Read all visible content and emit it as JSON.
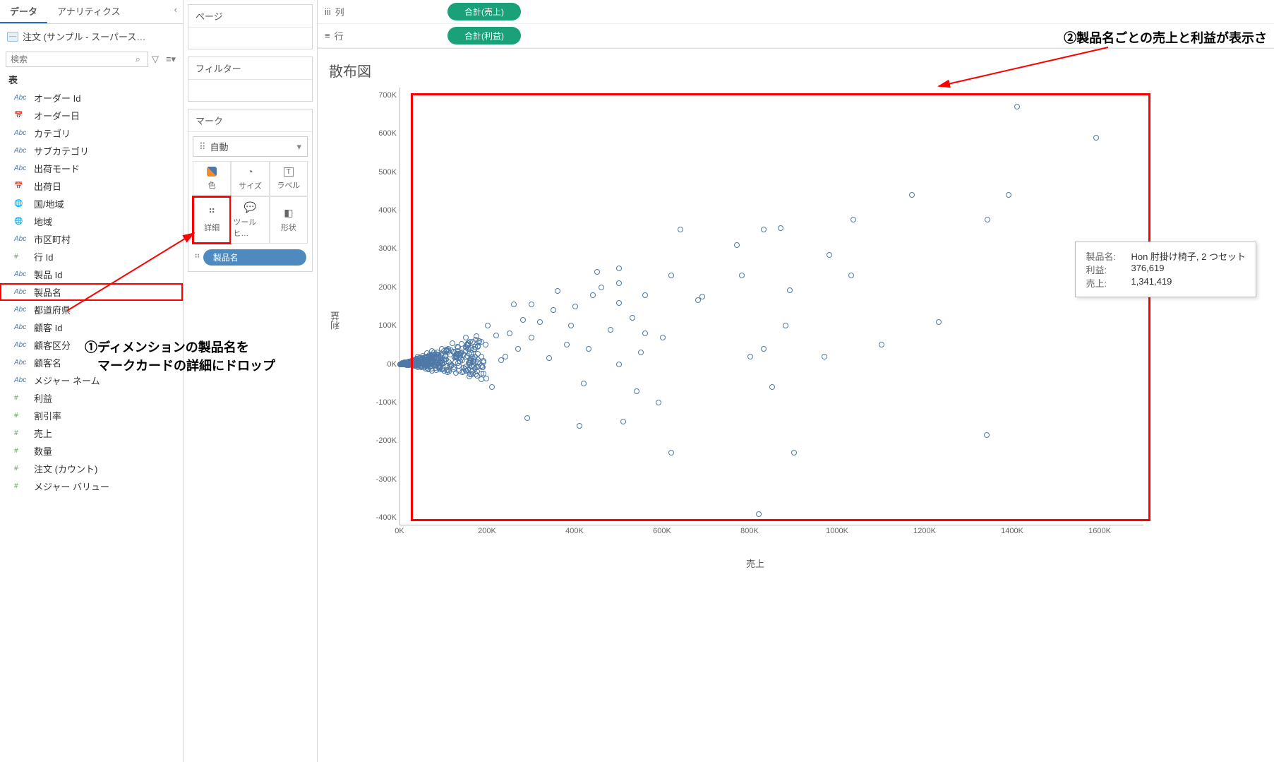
{
  "sidebar": {
    "tabs": {
      "data": "データ",
      "analytics": "アナリティクス"
    },
    "datasource": "注文 (サンプル - スーパース…",
    "search_placeholder": "検索",
    "section_header": "表",
    "fields": [
      {
        "type": "Abc",
        "name": "オーダー Id"
      },
      {
        "type": "date",
        "name": "オーダー日"
      },
      {
        "type": "Abc",
        "name": "カテゴリ"
      },
      {
        "type": "Abc",
        "name": "サブカテゴリ"
      },
      {
        "type": "Abc",
        "name": "出荷モード"
      },
      {
        "type": "date",
        "name": "出荷日"
      },
      {
        "type": "geo",
        "name": "国/地域"
      },
      {
        "type": "geo",
        "name": "地域"
      },
      {
        "type": "Abc",
        "name": "市区町村"
      },
      {
        "type": "#",
        "name": "行 Id"
      },
      {
        "type": "Abc",
        "name": "製品 Id"
      },
      {
        "type": "Abc",
        "name": "製品名",
        "highlighted": true
      },
      {
        "type": "Abc",
        "name": "都道府県"
      },
      {
        "type": "Abc",
        "name": "顧客 Id"
      },
      {
        "type": "Abc",
        "name": "顧客区分"
      },
      {
        "type": "Abc",
        "name": "顧客名"
      },
      {
        "type": "Abc",
        "name": "メジャー ネーム"
      },
      {
        "type": "#",
        "name": "利益"
      },
      {
        "type": "#",
        "name": "割引率"
      },
      {
        "type": "#",
        "name": "売上"
      },
      {
        "type": "#",
        "name": "数量"
      },
      {
        "type": "#",
        "name": "注文 (カウント)"
      },
      {
        "type": "#",
        "name": "メジャー バリュー"
      }
    ]
  },
  "cards": {
    "pages": "ページ",
    "filters": "フィルター",
    "marks": "マーク",
    "mark_type": "自動",
    "cells": {
      "color": "色",
      "size": "サイズ",
      "label": "ラベル",
      "detail": "詳細",
      "tooltip": "ツールヒ…",
      "shape": "形状"
    },
    "detail_pill": "製品名"
  },
  "shelves": {
    "columns_label": "列",
    "columns_pill": "合計(売上)",
    "rows_label": "行",
    "rows_pill": "合計(利益)"
  },
  "viz": {
    "title": "散布図",
    "y_axis": "利益",
    "x_axis": "売上",
    "y_ticks": [
      "700K",
      "600K",
      "500K",
      "400K",
      "300K",
      "200K",
      "100K",
      "0K",
      "-100K",
      "-200K",
      "-300K",
      "-400K"
    ],
    "x_ticks": [
      "0K",
      "200K",
      "400K",
      "600K",
      "800K",
      "1000K",
      "1200K",
      "1400K",
      "1600K"
    ],
    "tooltip": {
      "name_label": "製品名:",
      "name_val": "Hon 肘掛け椅子, 2 つセット",
      "profit_label": "利益:",
      "profit_val": "376,619",
      "sales_label": "売上:",
      "sales_val": "1,341,419"
    }
  },
  "annotations": {
    "step1": "①ディメンションの製品名を\n　マークカードの詳細にドロップ",
    "step2": "②製品名ごとの売上と利益が表示さ"
  },
  "chart_data": {
    "type": "scatter",
    "xlabel": "売上",
    "ylabel": "利益",
    "xlim": [
      0,
      1700000
    ],
    "ylim": [
      -420000,
      720000
    ],
    "sample_points_note": "Dense cluster near origin; hundreds of products. Representative points estimated from axes.",
    "series": [
      {
        "name": "製品",
        "points": [
          [
            1341419,
            376619
          ],
          [
            1410000,
            670000
          ],
          [
            1590000,
            590000
          ],
          [
            1390000,
            440000
          ],
          [
            1170000,
            440000
          ],
          [
            1035000,
            376000
          ],
          [
            1340000,
            -185000
          ],
          [
            980000,
            285000
          ],
          [
            1030000,
            230000
          ],
          [
            1100000,
            50000
          ],
          [
            1230000,
            110000
          ],
          [
            970000,
            20000
          ],
          [
            880000,
            100000
          ],
          [
            870000,
            355000
          ],
          [
            830000,
            350000
          ],
          [
            900000,
            -230000
          ],
          [
            820000,
            -390000
          ],
          [
            890000,
            192000
          ],
          [
            830000,
            40000
          ],
          [
            850000,
            -60000
          ],
          [
            800000,
            20000
          ],
          [
            780000,
            230000
          ],
          [
            770000,
            310000
          ],
          [
            690000,
            175000
          ],
          [
            680000,
            167000
          ],
          [
            640000,
            350000
          ],
          [
            620000,
            230000
          ],
          [
            600000,
            70000
          ],
          [
            590000,
            -100000
          ],
          [
            620000,
            -230000
          ],
          [
            560000,
            180000
          ],
          [
            560000,
            80000
          ],
          [
            550000,
            30000
          ],
          [
            530000,
            120000
          ],
          [
            540000,
            -70000
          ],
          [
            500000,
            250000
          ],
          [
            500000,
            210000
          ],
          [
            500000,
            160000
          ],
          [
            500000,
            0
          ],
          [
            510000,
            -150000
          ],
          [
            480000,
            90000
          ],
          [
            460000,
            200000
          ],
          [
            450000,
            240000
          ],
          [
            440000,
            180000
          ],
          [
            430000,
            40000
          ],
          [
            420000,
            -50000
          ],
          [
            410000,
            -160000
          ],
          [
            400000,
            150000
          ],
          [
            390000,
            100000
          ],
          [
            380000,
            50000
          ],
          [
            360000,
            190000
          ],
          [
            350000,
            140000
          ],
          [
            340000,
            15000
          ],
          [
            320000,
            110000
          ],
          [
            300000,
            155000
          ],
          [
            300000,
            70000
          ],
          [
            290000,
            -140000
          ],
          [
            280000,
            115000
          ],
          [
            270000,
            40000
          ],
          [
            260000,
            155000
          ],
          [
            250000,
            80000
          ],
          [
            240000,
            20000
          ],
          [
            230000,
            10000
          ],
          [
            220000,
            75000
          ],
          [
            210000,
            -60000
          ],
          [
            200000,
            100000
          ],
          [
            195000,
            50000
          ],
          [
            190000,
            5000
          ],
          [
            180000,
            60000
          ],
          [
            175000,
            -30000
          ],
          [
            170000,
            40000
          ],
          [
            165000,
            20000
          ],
          [
            160000,
            10000
          ],
          [
            155000,
            50000
          ],
          [
            150000,
            70000
          ],
          [
            145000,
            -20000
          ],
          [
            140000,
            30000
          ],
          [
            135000,
            15000
          ],
          [
            130000,
            45000
          ],
          [
            125000,
            5000
          ],
          [
            120000,
            55000
          ],
          [
            115000,
            25000
          ],
          [
            110000,
            -15000
          ],
          [
            105000,
            35000
          ],
          [
            100000,
            10000
          ],
          [
            95000,
            40000
          ],
          [
            90000,
            20000
          ],
          [
            88000,
            -10000
          ],
          [
            85000,
            30000
          ],
          [
            82000,
            5000
          ],
          [
            80000,
            25000
          ],
          [
            78000,
            15000
          ],
          [
            75000,
            8000
          ],
          [
            72000,
            35000
          ],
          [
            70000,
            -5000
          ],
          [
            68000,
            20000
          ],
          [
            65000,
            10000
          ],
          [
            62000,
            28000
          ],
          [
            60000,
            3000
          ],
          [
            58000,
            18000
          ],
          [
            55000,
            7000
          ],
          [
            52000,
            22000
          ],
          [
            50000,
            12000
          ],
          [
            48000,
            -8000
          ],
          [
            45000,
            15000
          ],
          [
            42000,
            5000
          ],
          [
            40000,
            20000
          ],
          [
            38000,
            8000
          ],
          [
            35000,
            12000
          ],
          [
            32000,
            3000
          ],
          [
            30000,
            10000
          ],
          [
            28000,
            5000
          ],
          [
            25000,
            8000
          ],
          [
            22000,
            2000
          ],
          [
            20000,
            6000
          ],
          [
            18000,
            3000
          ],
          [
            15000,
            5000
          ],
          [
            12000,
            2000
          ],
          [
            10000,
            4000
          ],
          [
            8000,
            1000
          ],
          [
            5000,
            2000
          ],
          [
            3000,
            500
          ]
        ]
      }
    ]
  }
}
